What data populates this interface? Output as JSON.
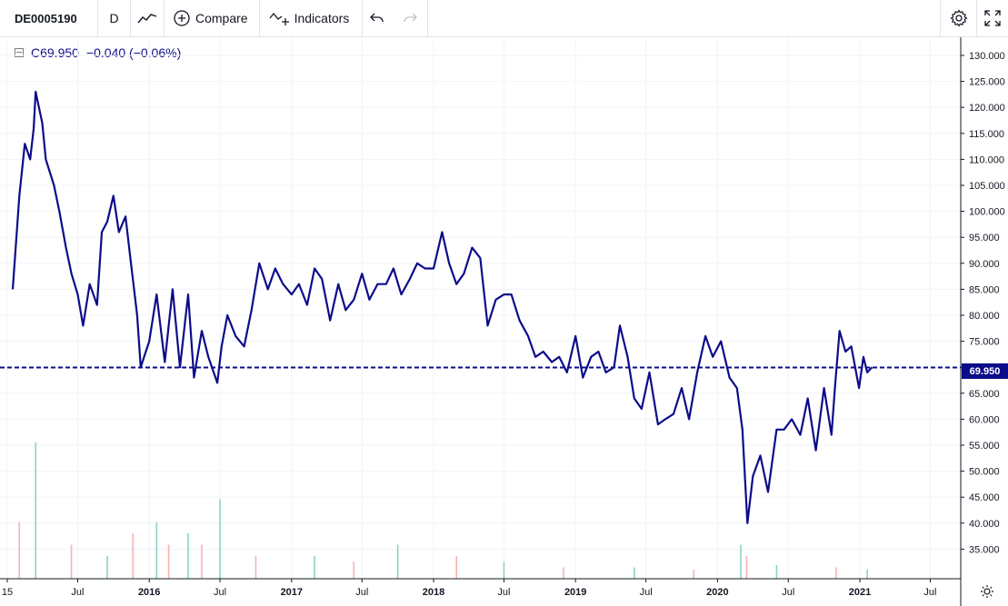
{
  "toolbar": {
    "symbol": "DE0005190",
    "interval": "D",
    "chart_type_icon": "line-chart-icon",
    "compare_label": "Compare",
    "indicators_label": "Indicators",
    "undo_icon": "undo-icon",
    "redo_icon": "redo-icon",
    "settings_icon": "gear-icon",
    "fullscreen_icon": "fullscreen-icon"
  },
  "legend": {
    "close": "C69.950",
    "change": "−0.040 (−0.06%)"
  },
  "colors": {
    "line": "#0c0c8a",
    "grid": "#f0f3fa",
    "volume_up": "#8fd1c4",
    "volume_down": "#f3b4b4"
  },
  "price_tag": "69.950",
  "chart_data": {
    "type": "line",
    "title": "",
    "xlabel": "",
    "ylabel": "",
    "ylim": [
      30,
      132
    ],
    "xlim": [
      "2015-01-15",
      "2021-12-31"
    ],
    "grid": true,
    "current_price": 69.95,
    "y_ticks": [
      "130.000",
      "125.000",
      "120.000",
      "115.000",
      "110.000",
      "105.000",
      "100.000",
      "95.000",
      "90.000",
      "85.000",
      "80.000",
      "75.000",
      "70.000",
      "65.000",
      "60.000",
      "55.000",
      "50.000",
      "45.000",
      "40.000",
      "35.000"
    ],
    "x_ticks": [
      {
        "date": "2015-01-01",
        "label": "15"
      },
      {
        "date": "2015-07-01",
        "label": "Jul"
      },
      {
        "date": "2016-01-01",
        "label": "2016"
      },
      {
        "date": "2016-07-01",
        "label": "Jul"
      },
      {
        "date": "2017-01-01",
        "label": "2017"
      },
      {
        "date": "2017-07-01",
        "label": "Jul"
      },
      {
        "date": "2018-01-01",
        "label": "2018"
      },
      {
        "date": "2018-07-01",
        "label": "Jul"
      },
      {
        "date": "2019-01-01",
        "label": "2019"
      },
      {
        "date": "2019-07-01",
        "label": "Jul"
      },
      {
        "date": "2020-01-01",
        "label": "2020"
      },
      {
        "date": "2020-07-01",
        "label": "Jul"
      },
      {
        "date": "2021-01-01",
        "label": "2021"
      },
      {
        "date": "2021-07-01",
        "label": "Jul"
      }
    ],
    "series": [
      {
        "x": [
          "2015-01-15",
          "2015-02-01",
          "2015-02-15",
          "2015-03-01",
          "2015-03-10",
          "2015-03-15",
          "2015-04-01",
          "2015-04-10",
          "2015-05-01",
          "2015-05-15",
          "2015-06-01",
          "2015-06-15",
          "2015-07-01",
          "2015-07-15",
          "2015-08-01",
          "2015-08-20",
          "2015-09-01",
          "2015-09-15",
          "2015-10-01",
          "2015-10-15",
          "2015-11-01",
          "2015-11-15",
          "2015-12-01",
          "2015-12-10",
          "2016-01-01",
          "2016-01-20",
          "2016-02-10",
          "2016-03-01",
          "2016-03-20",
          "2016-04-10",
          "2016-04-25",
          "2016-05-15",
          "2016-06-01",
          "2016-06-24",
          "2016-07-05",
          "2016-07-20",
          "2016-08-10",
          "2016-09-01",
          "2016-09-20",
          "2016-10-10",
          "2016-11-01",
          "2016-11-20",
          "2016-12-10",
          "2017-01-01",
          "2017-01-20",
          "2017-02-10",
          "2017-03-01",
          "2017-03-20",
          "2017-04-10",
          "2017-05-01",
          "2017-05-20",
          "2017-06-10",
          "2017-07-01",
          "2017-07-20",
          "2017-08-10",
          "2017-09-01",
          "2017-09-20",
          "2017-10-10",
          "2017-11-01",
          "2017-11-20",
          "2017-12-10",
          "2018-01-01",
          "2018-01-23",
          "2018-02-10",
          "2018-03-01",
          "2018-03-20",
          "2018-04-10",
          "2018-05-01",
          "2018-05-20",
          "2018-06-10",
          "2018-07-01",
          "2018-07-20",
          "2018-08-10",
          "2018-09-01",
          "2018-09-20",
          "2018-10-10",
          "2018-11-01",
          "2018-11-20",
          "2018-12-10",
          "2019-01-01",
          "2019-01-20",
          "2019-02-10",
          "2019-03-01",
          "2019-03-20",
          "2019-04-10",
          "2019-04-25",
          "2019-05-15",
          "2019-06-01",
          "2019-06-20",
          "2019-07-10",
          "2019-08-01",
          "2019-08-20",
          "2019-09-10",
          "2019-10-01",
          "2019-10-20",
          "2019-11-10",
          "2019-12-01",
          "2019-12-20",
          "2020-01-10",
          "2020-02-01",
          "2020-02-20",
          "2020-03-05",
          "2020-03-18",
          "2020-04-01",
          "2020-04-20",
          "2020-05-10",
          "2020-06-01",
          "2020-06-20",
          "2020-07-10",
          "2020-08-01",
          "2020-08-20",
          "2020-09-10",
          "2020-10-01",
          "2020-10-20",
          "2020-10-30",
          "2020-11-10",
          "2020-11-25",
          "2020-12-10",
          "2020-12-30",
          "2021-01-10",
          "2021-01-20",
          "2021-02-01"
        ],
        "values": [
          85,
          103,
          113,
          110,
          116,
          123,
          117,
          110,
          105,
          100,
          93,
          88,
          84,
          78,
          86,
          82,
          96,
          98,
          103,
          96,
          99,
          90,
          80,
          70,
          75,
          84,
          71,
          85,
          70,
          84,
          68,
          77,
          72,
          67,
          74,
          80,
          76,
          74,
          81,
          90,
          85,
          89,
          86,
          84,
          86,
          82,
          89,
          87,
          79,
          86,
          81,
          83,
          88,
          83,
          86,
          86,
          89,
          84,
          87,
          90,
          89,
          89,
          96,
          90,
          86,
          88,
          93,
          91,
          78,
          83,
          84,
          84,
          79,
          76,
          72,
          73,
          71,
          72,
          69,
          76,
          68,
          72,
          73,
          69,
          70,
          78,
          72,
          64,
          62,
          69,
          59,
          60,
          61,
          66,
          60,
          69,
          76,
          72,
          75,
          68,
          66,
          58,
          40,
          49,
          53,
          46,
          58,
          58,
          60,
          57,
          64,
          54,
          66,
          57,
          67,
          77,
          73,
          74,
          66,
          72,
          69,
          70
        ]
      }
    ],
    "volume": {
      "x": [
        "2015-02-01",
        "2015-03-15",
        "2015-06-15",
        "2015-09-15",
        "2015-11-20",
        "2016-01-20",
        "2016-02-20",
        "2016-04-10",
        "2016-05-15",
        "2016-07-01",
        "2016-10-01",
        "2017-03-01",
        "2017-06-10",
        "2017-10-01",
        "2018-03-01",
        "2018-07-01",
        "2018-12-01",
        "2019-06-01",
        "2019-11-01",
        "2020-03-01",
        "2020-03-16",
        "2020-06-01",
        "2020-11-01",
        "2021-01-20"
      ],
      "values": [
        5,
        12,
        3,
        2,
        4,
        5,
        3,
        4,
        3,
        7,
        2,
        2,
        1.5,
        3,
        2,
        1.5,
        1,
        1,
        0.8,
        3,
        2,
        1.2,
        1,
        0.8
      ]
    }
  }
}
